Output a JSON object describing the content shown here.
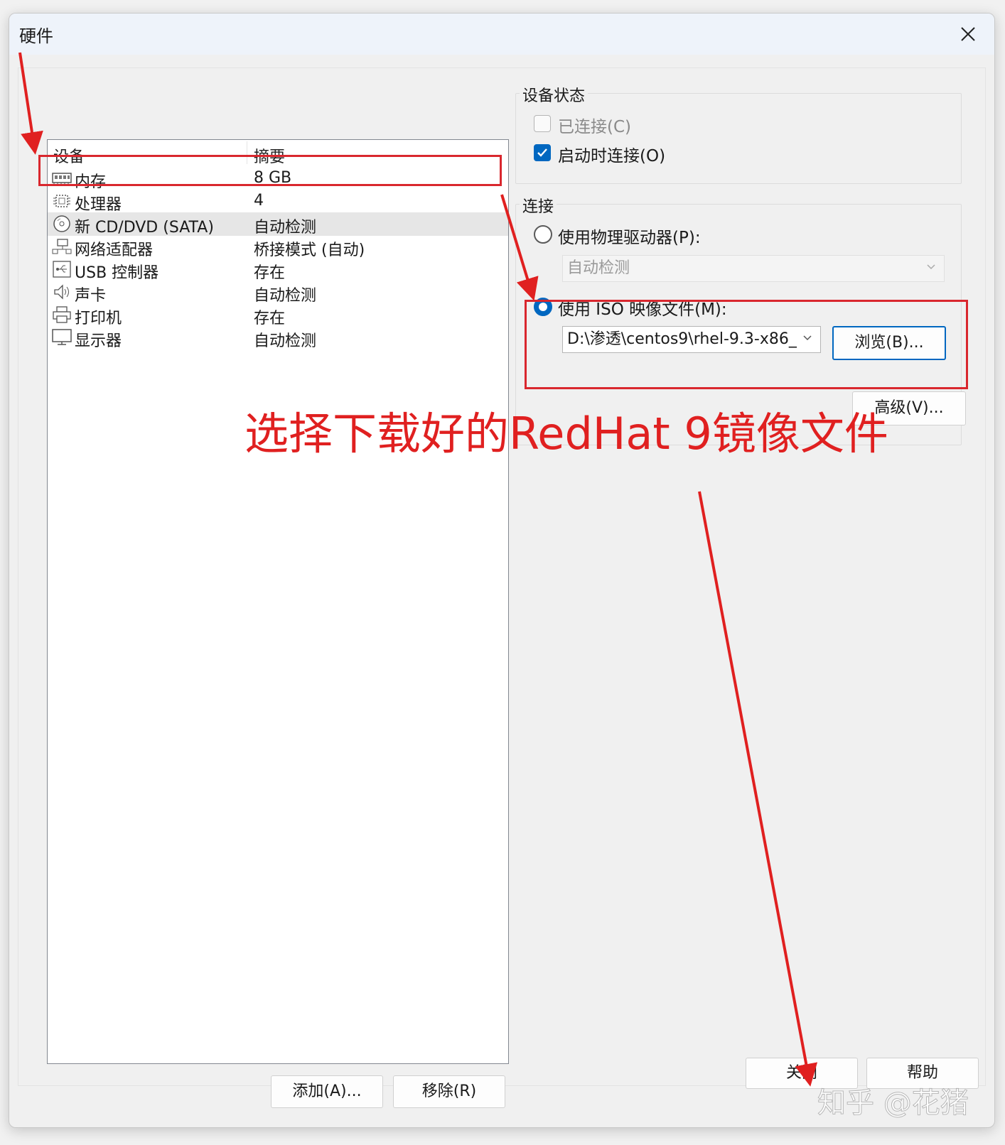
{
  "window": {
    "title": "硬件"
  },
  "device_list": {
    "columns": [
      "设备",
      "摘要"
    ],
    "rows": [
      {
        "name": "内存",
        "summary": "8 GB",
        "icon": "memory-icon"
      },
      {
        "name": "处理器",
        "summary": "4",
        "icon": "cpu-icon"
      },
      {
        "name": "新 CD/DVD (SATA)",
        "summary": "自动检测",
        "icon": "cd-dvd-icon",
        "selected": true
      },
      {
        "name": "网络适配器",
        "summary": "桥接模式 (自动)",
        "icon": "network-icon"
      },
      {
        "name": "USB 控制器",
        "summary": "存在",
        "icon": "usb-icon"
      },
      {
        "name": "声卡",
        "summary": "自动检测",
        "icon": "speaker-icon"
      },
      {
        "name": "打印机",
        "summary": "存在",
        "icon": "printer-icon"
      },
      {
        "name": "显示器",
        "summary": "自动检测",
        "icon": "monitor-icon"
      }
    ]
  },
  "list_buttons": {
    "add": "添加(A)...",
    "remove": "移除(R)"
  },
  "device_status": {
    "label": "设备状态",
    "connected": {
      "label": "已连接(C)",
      "checked": false,
      "disabled": true
    },
    "connect_at_power_on": {
      "label": "启动时连接(O)",
      "checked": true
    }
  },
  "connection": {
    "label": "连接",
    "physical": {
      "label": "使用物理驱动器(P):",
      "selected": false,
      "dropdown_value": "自动检测"
    },
    "iso": {
      "label": "使用 ISO 映像文件(M):",
      "selected": true,
      "path": "D:\\渗透\\centos9\\rhel-9.3-x86_",
      "browse": "浏览(B)..."
    },
    "advanced": "高级(V)..."
  },
  "footer": {
    "close": "关闭",
    "help": "帮助"
  },
  "annotation": {
    "text": "选择下载好的RedHat 9镜像文件",
    "color": "#e02020"
  },
  "watermark": "知乎 @花猪",
  "colors": {
    "accent": "#0067c0",
    "highlight_red": "#d9272e"
  }
}
